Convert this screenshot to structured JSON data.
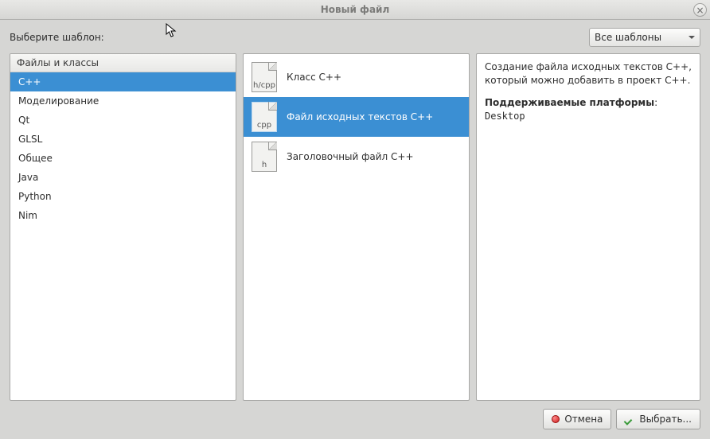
{
  "window": {
    "title": "Новый файл"
  },
  "prompt": "Выберите шаблон:",
  "filter": {
    "label": "Все шаблоны"
  },
  "categories": {
    "header": "Файлы и классы",
    "items": [
      {
        "label": "C++",
        "selected": true
      },
      {
        "label": "Моделирование",
        "selected": false
      },
      {
        "label": "Qt",
        "selected": false
      },
      {
        "label": "GLSL",
        "selected": false
      },
      {
        "label": "Общее",
        "selected": false
      },
      {
        "label": "Java",
        "selected": false
      },
      {
        "label": "Python",
        "selected": false
      },
      {
        "label": "Nim",
        "selected": false
      }
    ]
  },
  "templates": [
    {
      "ext": "h/cpp",
      "label": "Класс C++",
      "selected": false
    },
    {
      "ext": "cpp",
      "label": "Файл исходных текстов C++",
      "selected": true
    },
    {
      "ext": "h",
      "label": "Заголовочный файл C++",
      "selected": false
    }
  ],
  "description": {
    "text": "Создание файла исходных текстов C++, который можно добавить в проект C++.",
    "supported_label": "Поддерживаемые платформы",
    "supported_value": "Desktop"
  },
  "buttons": {
    "cancel": "Отмена",
    "choose": "Выбрать..."
  }
}
